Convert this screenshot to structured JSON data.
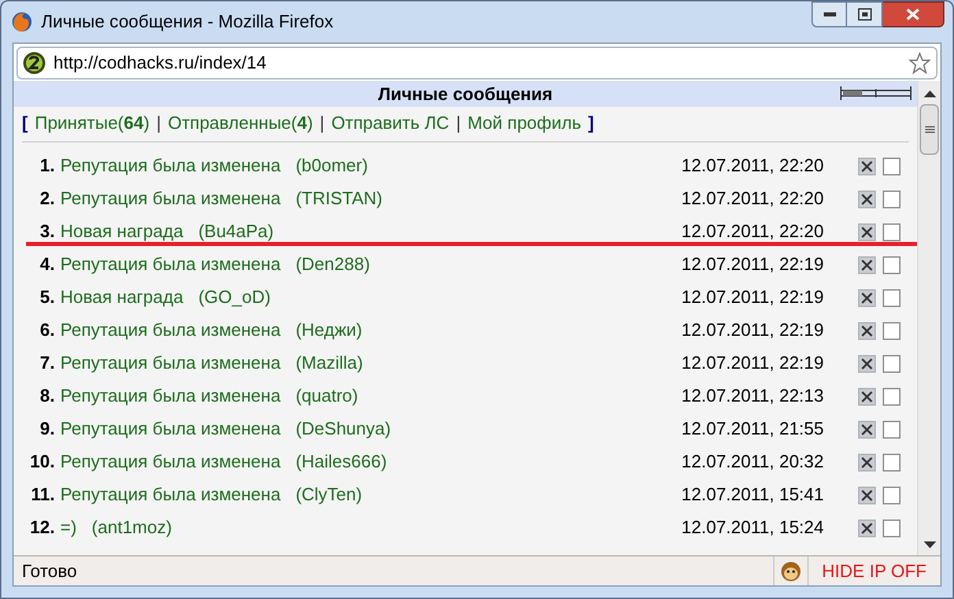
{
  "window": {
    "title": "Личные сообщения - Mozilla Firefox"
  },
  "address_bar": {
    "url": "http://codhacks.ru/index/14"
  },
  "panel": {
    "title": "Личные сообщения"
  },
  "nav": [
    {
      "kind": "open",
      "text": "["
    },
    {
      "kind": "link",
      "label": "Принятые(",
      "count": "64",
      "suffix": ")"
    },
    {
      "kind": "sep",
      "text": "|"
    },
    {
      "kind": "link",
      "label": "Отправленные(",
      "count": "4",
      "suffix": ")"
    },
    {
      "kind": "sep",
      "text": "|"
    },
    {
      "kind": "link",
      "label": "Отправить ЛС"
    },
    {
      "kind": "sep",
      "text": "|"
    },
    {
      "kind": "link",
      "label": "Мой профиль"
    },
    {
      "kind": "close",
      "text": "]"
    }
  ],
  "messages": [
    {
      "number": "1.",
      "subject": "Репутация была изменена",
      "author": "(b0omer)",
      "date": "12.07.2011, 22:20",
      "checked": false
    },
    {
      "number": "2.",
      "subject": "Репутация была изменена",
      "author": "(TRISTAN)",
      "date": "12.07.2011, 22:20",
      "checked": false
    },
    {
      "number": "3.",
      "subject": "Новая награда",
      "author": "(Bu4aPa)",
      "date": "12.07.2011, 22:20",
      "checked": false
    },
    {
      "number": "4.",
      "subject": "Репутация была изменена",
      "author": "(Den288)",
      "date": "12.07.2011, 22:19",
      "checked": false
    },
    {
      "number": "5.",
      "subject": "Новая награда",
      "author": "(GO_oD)",
      "date": "12.07.2011, 22:19",
      "checked": false
    },
    {
      "number": "6.",
      "subject": "Репутация была изменена",
      "author": "(Неджи)",
      "date": "12.07.2011, 22:19",
      "checked": false
    },
    {
      "number": "7.",
      "subject": "Репутация была изменена",
      "author": "(Mazilla)",
      "date": "12.07.2011, 22:19",
      "checked": false
    },
    {
      "number": "8.",
      "subject": "Репутация была изменена",
      "author": "(quatro)",
      "date": "12.07.2011, 22:13",
      "checked": false
    },
    {
      "number": "9.",
      "subject": "Репутация была изменена",
      "author": "(DeShunya)",
      "date": "12.07.2011, 21:55",
      "checked": false
    },
    {
      "number": "10.",
      "subject": "Репутация была изменена",
      "author": "(Hailes666)",
      "date": "12.07.2011, 20:32",
      "checked": false
    },
    {
      "number": "11.",
      "subject": "Репутация была изменена",
      "author": "(ClyTen)",
      "date": "12.07.2011, 15:41",
      "checked": false
    },
    {
      "number": "12.",
      "subject": "=)",
      "author": "(ant1moz)",
      "date": "12.07.2011, 15:24",
      "checked": false
    }
  ],
  "status_bar": {
    "text": "Готово",
    "addon": "HIDE IP OFF"
  }
}
